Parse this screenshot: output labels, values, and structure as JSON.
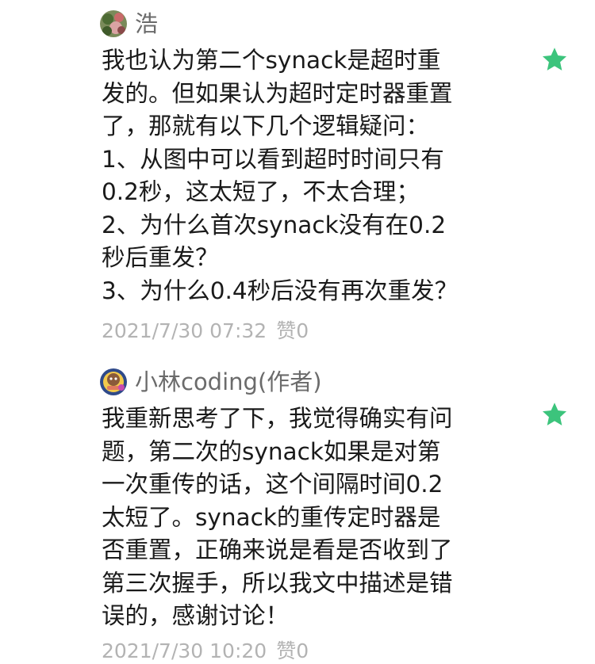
{
  "comments": [
    {
      "username": "浩",
      "avatar_icon": "nature-avatar",
      "lines": [
        "我也认为第二个synack是超时重",
        "发的。但如果认为超时定时器重置",
        "了，那就有以下几个逻辑疑问：",
        "1、从图中可以看到超时时间只有",
        "0.2秒，这太短了，不太合理；",
        "2、为什么首次synack没有在0.2",
        "秒后重发？",
        "3、为什么0.4秒后没有再次重发？"
      ],
      "timestamp": "2021/7/30 07:32",
      "likes": "赞0",
      "star_icon": "star-icon",
      "star_color": "#3cc47c"
    },
    {
      "username": "小林coding(作者)",
      "avatar_icon": "cartoon-avatar",
      "lines": [
        "我重新思考了下，我觉得确实有问",
        "题，第二次的synack如果是对第",
        "一次重传的话，这个间隔时间0.2",
        "太短了。synack的重传定时器是",
        "否重置，正确来说是看是否收到了",
        "第三次握手，所以我文中描述是错",
        "误的，感谢讨论！"
      ],
      "timestamp": "2021/7/30 10:20",
      "likes": "赞0",
      "star_icon": "star-icon",
      "star_color": "#3cc47c"
    }
  ]
}
